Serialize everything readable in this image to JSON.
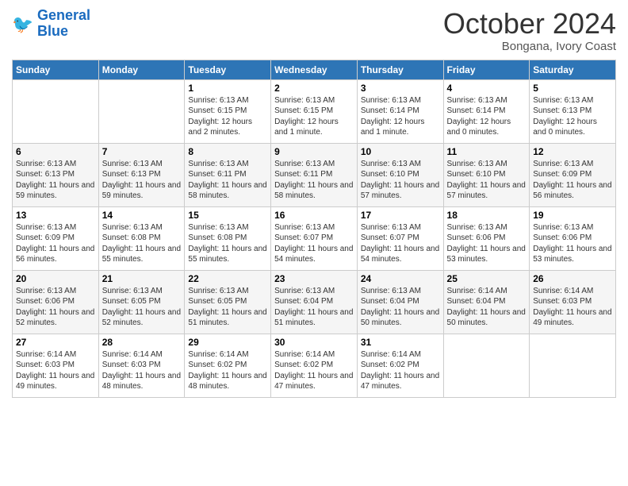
{
  "logo": {
    "line1": "General",
    "line2": "Blue"
  },
  "title": "October 2024",
  "location": "Bongana, Ivory Coast",
  "days_header": [
    "Sunday",
    "Monday",
    "Tuesday",
    "Wednesday",
    "Thursday",
    "Friday",
    "Saturday"
  ],
  "weeks": [
    [
      {
        "day": "",
        "info": ""
      },
      {
        "day": "",
        "info": ""
      },
      {
        "day": "1",
        "info": "Sunrise: 6:13 AM\nSunset: 6:15 PM\nDaylight: 12 hours and 2 minutes."
      },
      {
        "day": "2",
        "info": "Sunrise: 6:13 AM\nSunset: 6:15 PM\nDaylight: 12 hours and 1 minute."
      },
      {
        "day": "3",
        "info": "Sunrise: 6:13 AM\nSunset: 6:14 PM\nDaylight: 12 hours and 1 minute."
      },
      {
        "day": "4",
        "info": "Sunrise: 6:13 AM\nSunset: 6:14 PM\nDaylight: 12 hours and 0 minutes."
      },
      {
        "day": "5",
        "info": "Sunrise: 6:13 AM\nSunset: 6:13 PM\nDaylight: 12 hours and 0 minutes."
      }
    ],
    [
      {
        "day": "6",
        "info": "Sunrise: 6:13 AM\nSunset: 6:13 PM\nDaylight: 11 hours and 59 minutes."
      },
      {
        "day": "7",
        "info": "Sunrise: 6:13 AM\nSunset: 6:13 PM\nDaylight: 11 hours and 59 minutes."
      },
      {
        "day": "8",
        "info": "Sunrise: 6:13 AM\nSunset: 6:11 PM\nDaylight: 11 hours and 58 minutes."
      },
      {
        "day": "9",
        "info": "Sunrise: 6:13 AM\nSunset: 6:11 PM\nDaylight: 11 hours and 58 minutes."
      },
      {
        "day": "10",
        "info": "Sunrise: 6:13 AM\nSunset: 6:10 PM\nDaylight: 11 hours and 57 minutes."
      },
      {
        "day": "11",
        "info": "Sunrise: 6:13 AM\nSunset: 6:10 PM\nDaylight: 11 hours and 57 minutes."
      },
      {
        "day": "12",
        "info": "Sunrise: 6:13 AM\nSunset: 6:09 PM\nDaylight: 11 hours and 56 minutes."
      }
    ],
    [
      {
        "day": "13",
        "info": "Sunrise: 6:13 AM\nSunset: 6:09 PM\nDaylight: 11 hours and 56 minutes."
      },
      {
        "day": "14",
        "info": "Sunrise: 6:13 AM\nSunset: 6:08 PM\nDaylight: 11 hours and 55 minutes."
      },
      {
        "day": "15",
        "info": "Sunrise: 6:13 AM\nSunset: 6:08 PM\nDaylight: 11 hours and 55 minutes."
      },
      {
        "day": "16",
        "info": "Sunrise: 6:13 AM\nSunset: 6:07 PM\nDaylight: 11 hours and 54 minutes."
      },
      {
        "day": "17",
        "info": "Sunrise: 6:13 AM\nSunset: 6:07 PM\nDaylight: 11 hours and 54 minutes."
      },
      {
        "day": "18",
        "info": "Sunrise: 6:13 AM\nSunset: 6:06 PM\nDaylight: 11 hours and 53 minutes."
      },
      {
        "day": "19",
        "info": "Sunrise: 6:13 AM\nSunset: 6:06 PM\nDaylight: 11 hours and 53 minutes."
      }
    ],
    [
      {
        "day": "20",
        "info": "Sunrise: 6:13 AM\nSunset: 6:06 PM\nDaylight: 11 hours and 52 minutes."
      },
      {
        "day": "21",
        "info": "Sunrise: 6:13 AM\nSunset: 6:05 PM\nDaylight: 11 hours and 52 minutes."
      },
      {
        "day": "22",
        "info": "Sunrise: 6:13 AM\nSunset: 6:05 PM\nDaylight: 11 hours and 51 minutes."
      },
      {
        "day": "23",
        "info": "Sunrise: 6:13 AM\nSunset: 6:04 PM\nDaylight: 11 hours and 51 minutes."
      },
      {
        "day": "24",
        "info": "Sunrise: 6:13 AM\nSunset: 6:04 PM\nDaylight: 11 hours and 50 minutes."
      },
      {
        "day": "25",
        "info": "Sunrise: 6:14 AM\nSunset: 6:04 PM\nDaylight: 11 hours and 50 minutes."
      },
      {
        "day": "26",
        "info": "Sunrise: 6:14 AM\nSunset: 6:03 PM\nDaylight: 11 hours and 49 minutes."
      }
    ],
    [
      {
        "day": "27",
        "info": "Sunrise: 6:14 AM\nSunset: 6:03 PM\nDaylight: 11 hours and 49 minutes."
      },
      {
        "day": "28",
        "info": "Sunrise: 6:14 AM\nSunset: 6:03 PM\nDaylight: 11 hours and 48 minutes."
      },
      {
        "day": "29",
        "info": "Sunrise: 6:14 AM\nSunset: 6:02 PM\nDaylight: 11 hours and 48 minutes."
      },
      {
        "day": "30",
        "info": "Sunrise: 6:14 AM\nSunset: 6:02 PM\nDaylight: 11 hours and 47 minutes."
      },
      {
        "day": "31",
        "info": "Sunrise: 6:14 AM\nSunset: 6:02 PM\nDaylight: 11 hours and 47 minutes."
      },
      {
        "day": "",
        "info": ""
      },
      {
        "day": "",
        "info": ""
      }
    ]
  ]
}
